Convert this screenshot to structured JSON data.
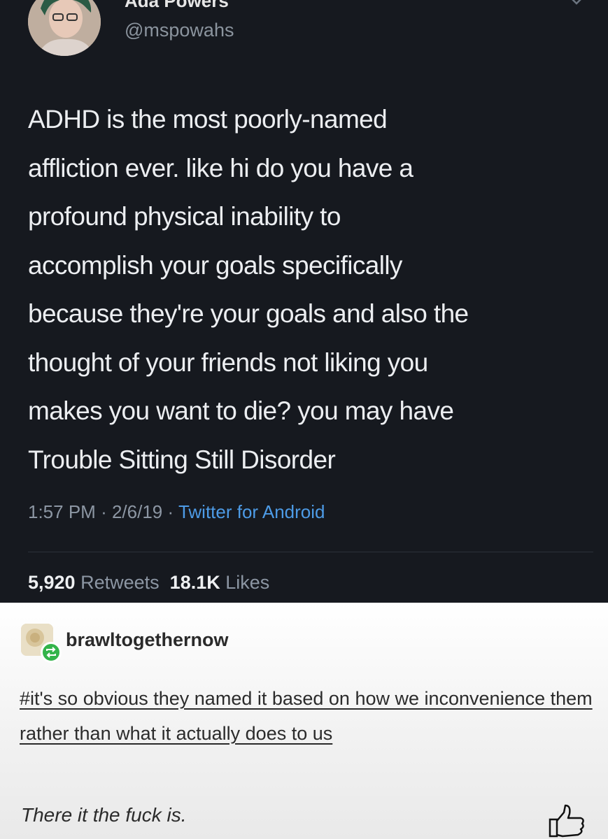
{
  "tweet": {
    "display_name": "Ada Powers",
    "handle": "@mspowahs",
    "text": "ADHD is the most poorly-named\naffliction ever. like hi do you have a\nprofound physical inability to\naccomplish your goals specifically\nbecause they're your goals and also the\nthought of your friends not liking you\nmakes you want to die? you may have\nTrouble Sitting Still Disorder",
    "time": "1:57 PM",
    "date": "2/6/19",
    "separator": "·",
    "source": "Twitter for Android",
    "retweets_count": "5,920",
    "retweets_label": "Retweets",
    "likes_count": "18.1K",
    "likes_label": "Likes",
    "source_color": "#4d9be6"
  },
  "tumblr": {
    "username": "brawltogethernow",
    "tags": "#it's so obvious they named it based on how we inconvenience them rather than what it actually does to us",
    "comment": "There it the fuck is.",
    "reblog_badge_color": "#33b44a",
    "icons": {
      "avatar": "user-avatar",
      "reblog": "reblog-icon",
      "thumb": "thumbs-up-icon",
      "caret": "chevron-down-icon"
    }
  }
}
